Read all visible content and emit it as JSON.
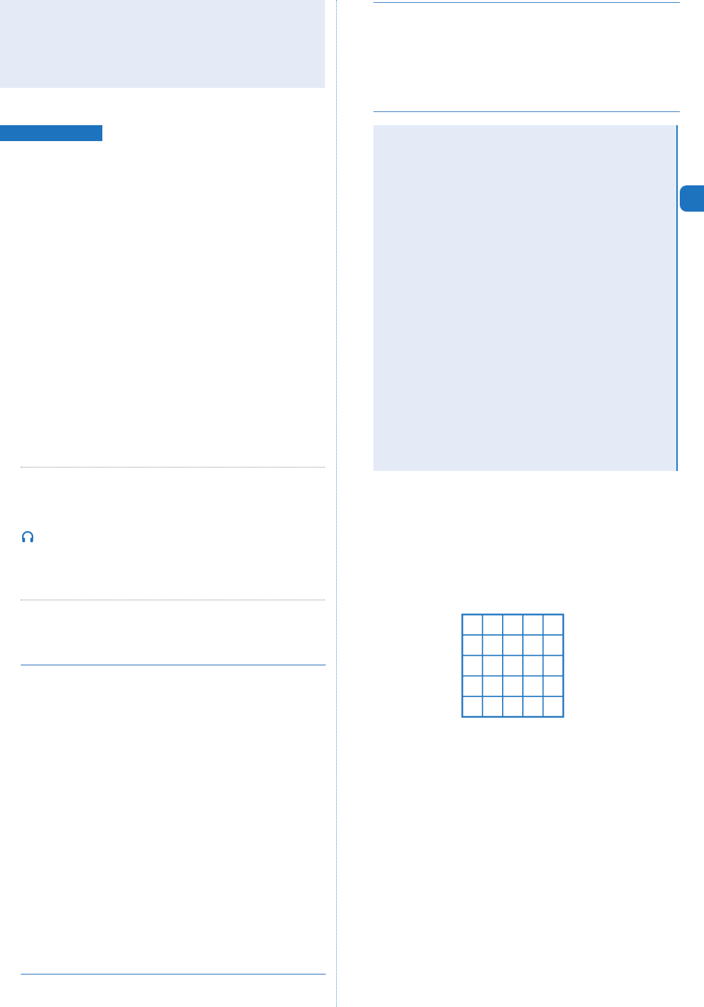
{
  "colors": {
    "accent": "#1e73be",
    "panel_background": "#e4ebf7",
    "rule_blue": "#2a6fb8",
    "divider_teal": "#3aa0b8",
    "dotted_gray": "#8a8a8a"
  },
  "left_column": {
    "top_panel": {},
    "section_label_bar": {},
    "note_box": {
      "icon": "headphones-icon"
    }
  },
  "right_column": {
    "info_panel": {},
    "chapter_tab": {},
    "grid": {
      "rows": 5,
      "cols": 5
    }
  }
}
